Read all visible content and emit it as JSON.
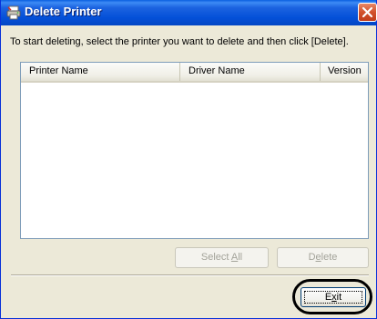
{
  "window": {
    "title": "Delete Printer",
    "icon": "printer-icon",
    "close_icon": "close-icon"
  },
  "instruction": "To start deleting, select the printer you want to delete and then click [Delete].",
  "printer_list": {
    "columns": [
      "Printer Name",
      "Driver Name",
      "Version"
    ],
    "rows": []
  },
  "buttons": {
    "select_all_pre": "Select ",
    "select_all_mnemonic": "A",
    "select_all_post": "ll",
    "delete_pre": "D",
    "delete_mnemonic": "e",
    "delete_post": "lete",
    "exit_pre": "E",
    "exit_mnemonic": "x",
    "exit_post": "it"
  },
  "colors": {
    "titlebar": "#0450d8",
    "close_button": "#d2512c",
    "dialog_background": "#ece9d8",
    "highlight_ring": "#000000"
  }
}
